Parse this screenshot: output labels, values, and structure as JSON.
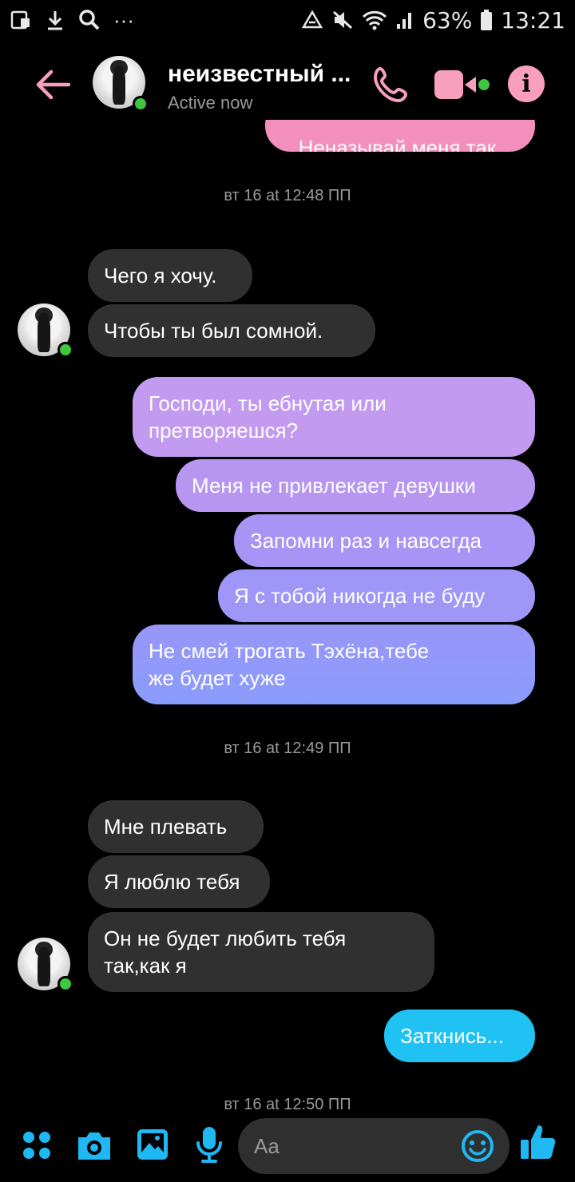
{
  "status_bar": {
    "battery": "63%",
    "time": "13:21",
    "left_icons": [
      "screenshot-icon",
      "download-icon",
      "search-icon",
      "more-icon"
    ],
    "right_icons": [
      "recycle-icon",
      "mute-icon",
      "wifi-icon",
      "signal-icon",
      "battery-icon"
    ]
  },
  "header": {
    "contact_name": "неизвестный ...",
    "status": "Active now",
    "accent_color": "#f79fbd"
  },
  "conversation": {
    "top_partial_message": "Неназывай меня так.",
    "timestamps": [
      "вт 16 at 12:48 ПП",
      "вт 16 at 12:49 ПП",
      "вт 16 at 12:50 ПП"
    ],
    "incoming_group_1": [
      "Чего я хочу.",
      "Чтобы ты был сомной."
    ],
    "outgoing_group_1": [
      "Господи, ты ебнутая или\nпретворяешся?",
      "Меня не привлекает девушки",
      "Запомни раз и навсегда",
      "Я с тобой никогда не буду",
      "Не смей трогать Тэхёна,тебе\nже будет хуже"
    ],
    "incoming_group_2": [
      "Мне плевать",
      "Я люблю тебя",
      "Он не будет любить тебя\nтак,как я"
    ],
    "outgoing_group_2": [
      "Заткнись..."
    ]
  },
  "composer": {
    "placeholder": "Aa",
    "icons": [
      "apps-icon",
      "camera-icon",
      "gallery-icon",
      "microphone-icon",
      "emoji-icon",
      "thumbs-up-icon"
    ],
    "accent_color": "#1fb8f2"
  }
}
